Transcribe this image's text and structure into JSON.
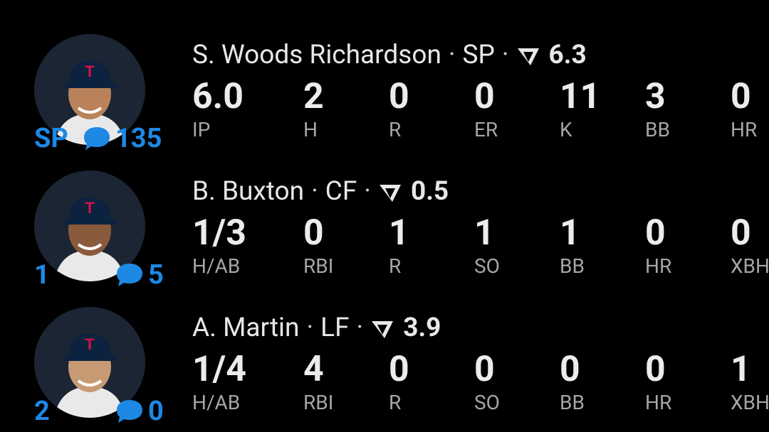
{
  "players": [
    {
      "name": "S. Woods Richardson",
      "position": "SP",
      "score": "6.3",
      "badge_left": "SP",
      "comment_count": "135",
      "stats": [
        {
          "label": "IP",
          "value": "6.0"
        },
        {
          "label": "H",
          "value": "2"
        },
        {
          "label": "R",
          "value": "0"
        },
        {
          "label": "ER",
          "value": "0"
        },
        {
          "label": "K",
          "value": "11"
        },
        {
          "label": "BB",
          "value": "3"
        },
        {
          "label": "HR",
          "value": "0"
        }
      ]
    },
    {
      "name": "B. Buxton",
      "position": "CF",
      "score": "0.5",
      "badge_left": "1",
      "comment_count": "5",
      "stats": [
        {
          "label": "H/AB",
          "value": "1/3"
        },
        {
          "label": "RBI",
          "value": "0"
        },
        {
          "label": "R",
          "value": "1"
        },
        {
          "label": "SO",
          "value": "1"
        },
        {
          "label": "BB",
          "value": "1"
        },
        {
          "label": "HR",
          "value": "0"
        },
        {
          "label": "XBH",
          "value": "0"
        }
      ]
    },
    {
      "name": "A. Martin",
      "position": "LF",
      "score": "3.9",
      "badge_left": "2",
      "comment_count": "0",
      "stats": [
        {
          "label": "H/AB",
          "value": "1/4"
        },
        {
          "label": "RBI",
          "value": "4"
        },
        {
          "label": "R",
          "value": "0"
        },
        {
          "label": "SO",
          "value": "0"
        },
        {
          "label": "BB",
          "value": "0"
        },
        {
          "label": "HR",
          "value": "0"
        },
        {
          "label": "XBH",
          "value": "1"
        }
      ]
    }
  ],
  "separator": "·",
  "icons": {
    "comment": "chat-bubble-icon",
    "score": "score-flag-icon",
    "avatar": "player-headshot"
  },
  "colors": {
    "background": "#000000",
    "accent": "#1e88e5",
    "text": "#e8e8e8",
    "label": "#a6a6a6",
    "cap": "#0c2340",
    "cap_logo": "#d31145"
  }
}
